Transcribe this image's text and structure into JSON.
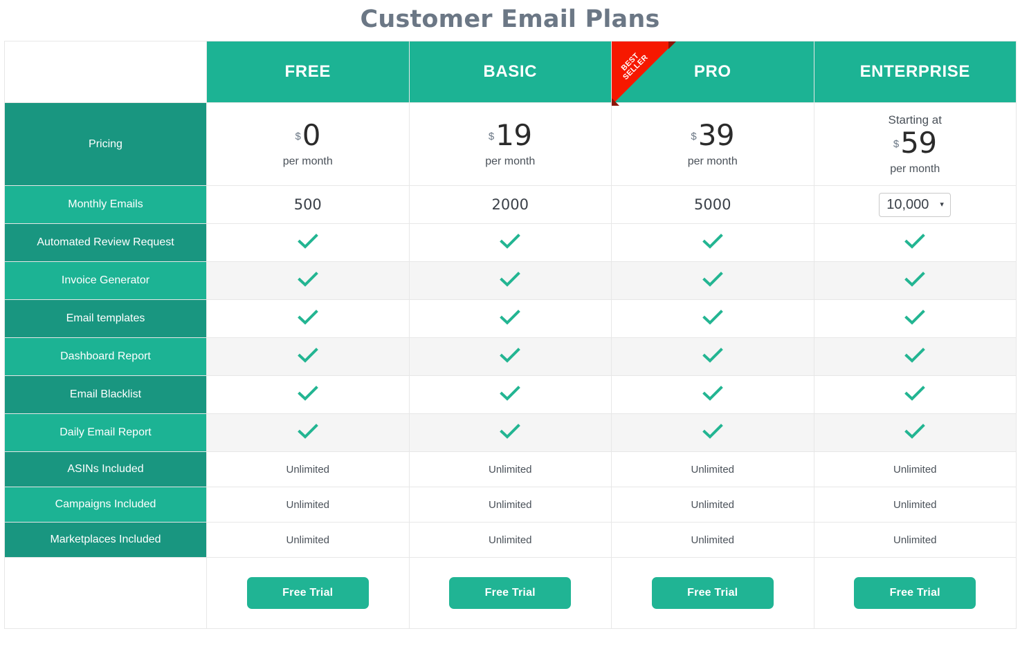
{
  "page": {
    "title": "Customer Email Plans"
  },
  "table": {
    "feature_column_header": "",
    "plans": [
      {
        "name": "FREE",
        "badge": null
      },
      {
        "name": "BASIC",
        "badge": null
      },
      {
        "name": "PRO",
        "badge": {
          "line1": "BEST",
          "line2": "SELLER"
        }
      },
      {
        "name": "ENTERPRISE",
        "badge": null
      }
    ],
    "rows": [
      {
        "label": "Pricing",
        "type": "price",
        "cells": [
          {
            "starting_at": null,
            "currency": "$",
            "amount": "0",
            "period": "per month"
          },
          {
            "starting_at": null,
            "currency": "$",
            "amount": "19",
            "period": "per month"
          },
          {
            "starting_at": null,
            "currency": "$",
            "amount": "39",
            "period": "per month"
          },
          {
            "starting_at": "Starting at",
            "currency": "$",
            "amount": "59",
            "period": "per month"
          }
        ]
      },
      {
        "label": "Monthly Emails",
        "type": "value",
        "cells": [
          {
            "text": "500"
          },
          {
            "text": "2000"
          },
          {
            "text": "5000"
          },
          {
            "select": {
              "value": "10,000",
              "caret": "▾"
            }
          }
        ]
      },
      {
        "label": "Automated Review Request",
        "type": "check",
        "cells": [
          true,
          true,
          true,
          true
        ]
      },
      {
        "label": "Invoice Generator",
        "type": "check",
        "cells": [
          true,
          true,
          true,
          true
        ]
      },
      {
        "label": "Email templates",
        "type": "check",
        "cells": [
          true,
          true,
          true,
          true
        ]
      },
      {
        "label": "Dashboard Report",
        "type": "check",
        "cells": [
          true,
          true,
          true,
          true
        ]
      },
      {
        "label": "Email Blacklist",
        "type": "check",
        "cells": [
          true,
          true,
          true,
          true
        ]
      },
      {
        "label": "Daily Email Report",
        "type": "check",
        "cells": [
          true,
          true,
          true,
          true
        ]
      },
      {
        "label": "ASINs Included",
        "type": "text",
        "cells": [
          "Unlimited",
          "Unlimited",
          "Unlimited",
          "Unlimited"
        ]
      },
      {
        "label": "Campaigns Included",
        "type": "text",
        "cells": [
          "Unlimited",
          "Unlimited",
          "Unlimited",
          "Unlimited"
        ]
      },
      {
        "label": "Marketplaces Included",
        "type": "text",
        "cells": [
          "Unlimited",
          "Unlimited",
          "Unlimited",
          "Unlimited"
        ]
      }
    ],
    "footer": {
      "buttons": [
        "Free Trial",
        "Free Trial",
        "Free Trial",
        "Free Trial"
      ]
    }
  },
  "colors": {
    "header_teal": "#1cb394",
    "feature_dark": "#199680",
    "feature_light": "#1cb394",
    "check_green": "#23b592",
    "button_green": "#20b494",
    "ribbon_red": "#f61800",
    "ribbon_fold": "#8d1407",
    "stripe_gray": "#f5f5f5",
    "title_gray": "#6b7785"
  }
}
